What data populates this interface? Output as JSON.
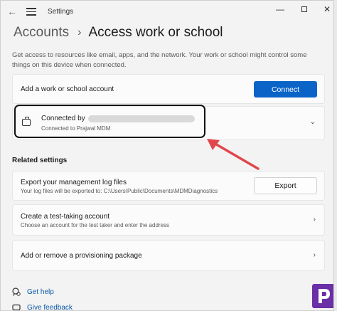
{
  "titlebar": {
    "title": "Settings",
    "back_icon": "back-arrow-icon",
    "menu_icon": "hamburger-icon",
    "minimize": "—",
    "close": "✕"
  },
  "breadcrumb": {
    "parent": "Accounts",
    "separator": "›",
    "current": "Access work or school"
  },
  "description": "Get access to resources like email, apps, and the network. Your work or school might control some things on this device when connected.",
  "add_account": {
    "label": "Add a work or school account",
    "button": "Connect"
  },
  "connection": {
    "title_prefix": "Connected by",
    "subtitle": "Connected to Prajwal MDM",
    "icon": "briefcase-icon",
    "expand_icon": "chevron-down-icon"
  },
  "related_settings": {
    "heading": "Related settings",
    "export": {
      "title": "Export your management log files",
      "subtitle": "Your log files will be exported to: C:\\Users\\Public\\Documents\\MDMDiagnostics",
      "button": "Export"
    },
    "test_account": {
      "title": "Create a test-taking account",
      "subtitle": "Choose an account for the test taker and enter the address",
      "icon": "chevron-right-icon"
    },
    "provisioning": {
      "title": "Add or remove a provisioning package",
      "icon": "chevron-right-icon"
    }
  },
  "footer": {
    "help": "Get help",
    "feedback": "Give feedback"
  },
  "colors": {
    "accent": "#0a64c8",
    "annotation_arrow": "#e0474c",
    "logo": "#6b2fa8"
  }
}
